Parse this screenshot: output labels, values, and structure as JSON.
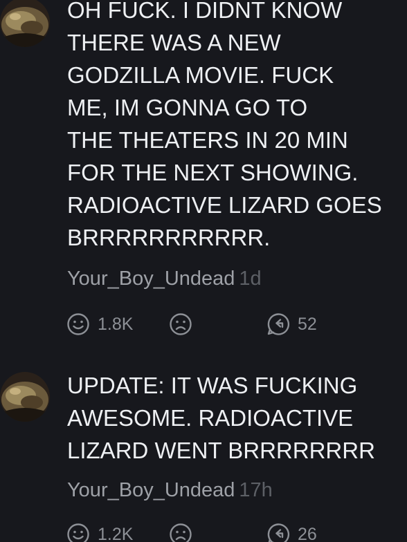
{
  "comments": [
    {
      "text": "OH FUCK. I DIDNT KNOW\nTHERE WAS A NEW\nGODZILLA MOVIE. FUCK\nME, IM GONNA GO TO\nTHE THEATERS IN 20 MIN\nFOR THE NEXT SHOWING.\nRADIOACTIVE LIZARD GOES\nBRRRRRRRRRRR.",
      "username": "Your_Boy_Undead",
      "age": "1d",
      "like_count": "1.8K",
      "reply_count": "52",
      "icons": {
        "like": "smile-icon",
        "dislike": "frown-icon",
        "reply": "reply-bubble-icon"
      }
    },
    {
      "text": "UPDATE: IT WAS FUCKING\nAWESOME. RADIOACTIVE\nLIZARD WENT BRRRRRRRR",
      "username": "Your_Boy_Undead",
      "age": "17h",
      "like_count": "1.2K",
      "reply_count": "26",
      "icons": {
        "like": "smile-icon",
        "dislike": "frown-icon",
        "reply": "reply-bubble-icon"
      }
    }
  ],
  "colors": {
    "background": "#17181d",
    "text": "#eef0f3",
    "username": "#9ea1a7",
    "timestamp": "#5d6066",
    "icon": "#8d9096"
  }
}
